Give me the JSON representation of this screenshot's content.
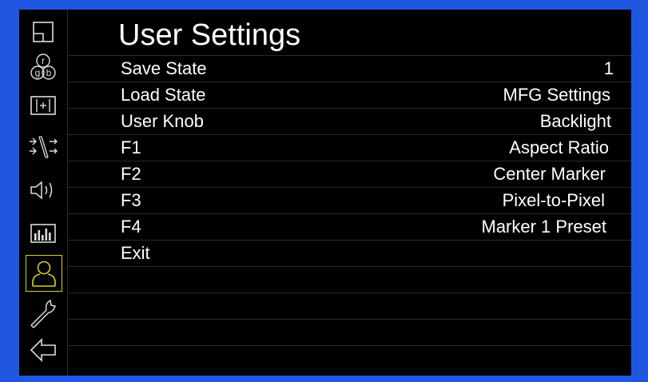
{
  "title": "User Settings",
  "sidebar": {
    "items": [
      {
        "icon": "picture-layout-icon"
      },
      {
        "icon": "rgb-color-icon",
        "letters": [
          "r",
          "g",
          "b"
        ]
      },
      {
        "icon": "marker-icon"
      },
      {
        "icon": "input-signal-icon"
      },
      {
        "icon": "speaker-icon"
      },
      {
        "icon": "histogram-icon"
      },
      {
        "icon": "user-icon",
        "selected": true
      },
      {
        "icon": "wrench-icon"
      },
      {
        "icon": "back-arrow-icon"
      }
    ],
    "accent": "#d9cf2a"
  },
  "menu": {
    "rows": [
      {
        "label": "Save State",
        "value": "1"
      },
      {
        "label": "Load State",
        "value": "MFG Settings"
      },
      {
        "label": "User Knob",
        "value": "Backlight"
      },
      {
        "label": "F1",
        "value": "Aspect Ratio"
      },
      {
        "label": "F2",
        "value": "Center Marker"
      },
      {
        "label": "F3",
        "value": "Pixel-to-Pixel"
      },
      {
        "label": "F4",
        "value": "Marker 1 Preset"
      },
      {
        "label": "Exit",
        "value": ""
      },
      {
        "label": "",
        "value": ""
      },
      {
        "label": "",
        "value": ""
      },
      {
        "label": "",
        "value": ""
      }
    ]
  },
  "colors": {
    "frame": "#1f57e0",
    "background": "#000000",
    "text": "#ffffff"
  }
}
